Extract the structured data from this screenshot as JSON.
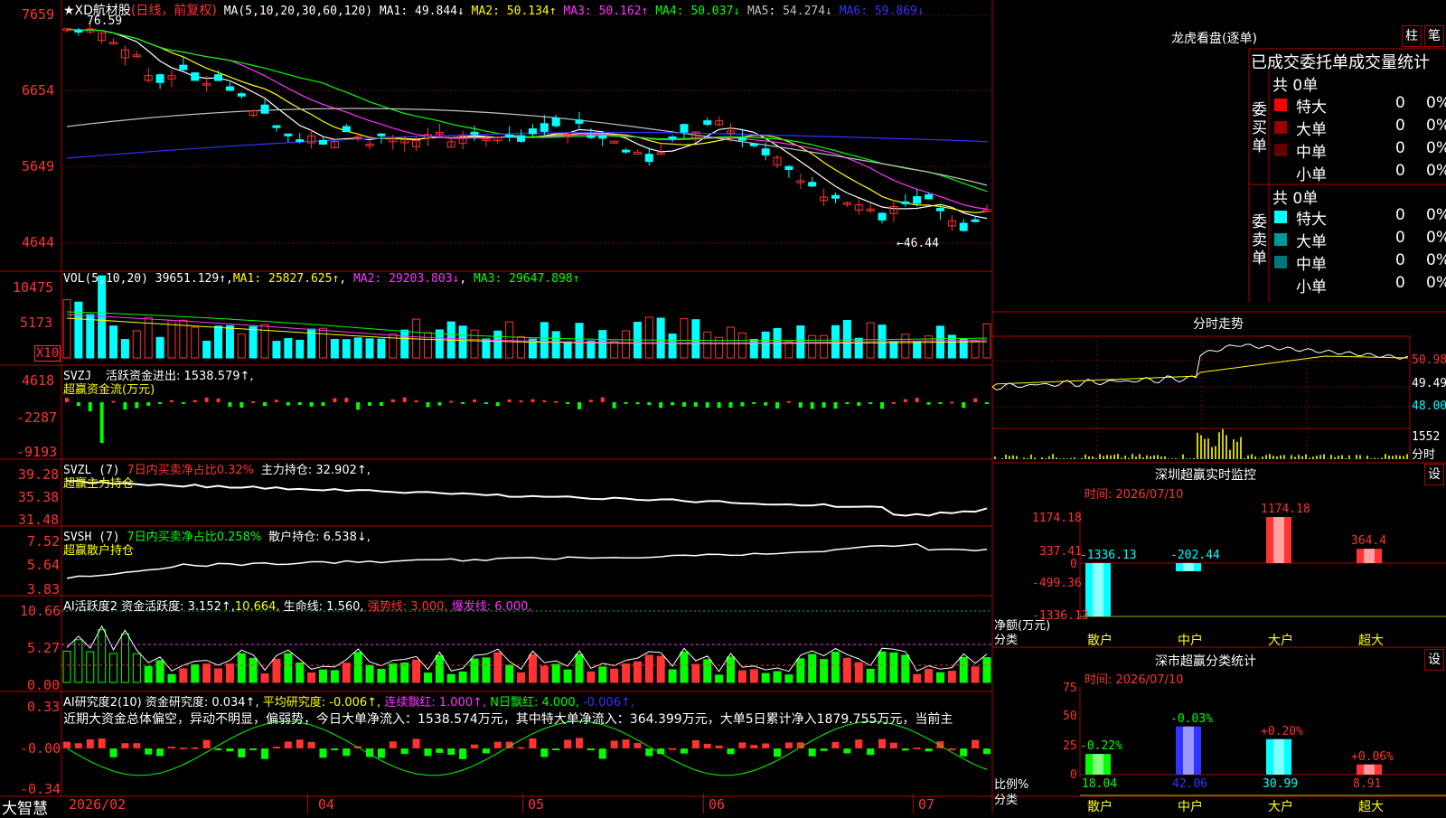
{
  "stock": {
    "title": "★XD航材股",
    "period": "(日线，前复权)",
    "ma_label": "MA(5,10,20,30,60,120)",
    "ma_values": [
      {
        "name": "MA1",
        "value": "49.844↓",
        "color": "#ffffff"
      },
      {
        "name": "MA2",
        "value": "50.134↑",
        "color": "#ffff00"
      },
      {
        "name": "MA3",
        "value": "50.162↑",
        "color": "#ff33ff"
      },
      {
        "name": "MA4",
        "value": "50.037↓",
        "color": "#00ff00"
      },
      {
        "name": "MA5",
        "value": "54.274↓",
        "color": "#c0c0c0"
      },
      {
        "name": "MA6",
        "value": "59.869↓",
        "color": "#3333ff"
      }
    ],
    "high_mark": "76.59",
    "low_mark": "←46.44",
    "price_ticks": [
      "7659",
      "6654",
      "5649",
      "4644"
    ],
    "x_ticks": [
      "2026/02",
      "04",
      "05",
      "06",
      "07"
    ],
    "brand": "大智慧"
  },
  "panels": {
    "vol": {
      "label": "VOL(5,10,20)",
      "value": "39651.129↑",
      "items": [
        {
          "name": "MA1",
          "value": "25827.625↑",
          "color": "#ffff00"
        },
        {
          "name": "MA2",
          "value": "29203.803↓",
          "color": "#ff33ff"
        },
        {
          "name": "MA3",
          "value": "29647.898↑",
          "color": "#00ff00"
        }
      ],
      "ticks": [
        "10475",
        "5173"
      ],
      "unit": "X10"
    },
    "svzj": {
      "label": "SVZJ",
      "text": "活跃资金进出: 1538.579↑,",
      "sub": "超赢资金流(万元)",
      "ticks": [
        "4618",
        "-2287",
        "-9193"
      ]
    },
    "svzl": {
      "label": "SVZL (7)",
      "text1": "7日内买卖净占比0.32%",
      "text2": "主力持仓: 32.902↑,",
      "sub": "超赢主力持仓",
      "ticks": [
        "39.28",
        "35.38",
        "31.48"
      ]
    },
    "svsh": {
      "label": "SVSH (7)",
      "text1": "7日内买卖净占比0.258%",
      "text2": "散户持仓: 6.538↓,",
      "sub": "超赢散户持仓",
      "ticks": [
        "7.52",
        "5.64",
        "3.83"
      ]
    },
    "ai1": {
      "label": "AI活跃度2",
      "t1": "资金活跃度: 3.152↑,",
      "t2": "10.664,",
      "t3": "生命线: 1.560,",
      "t4": "强势线: 3.000,",
      "t5": "爆发线: 6.000,",
      "ticks": [
        "10.66",
        "5.27",
        "0.00"
      ]
    },
    "ai2": {
      "label": "AI研究度2(10)",
      "t1": "资金研究度: 0.034↑,",
      "t2": "平均研究度: -0.006↑,",
      "t3": "连续飘红: 1.000↑,",
      "t4": "N日飘红: 4.000,",
      "t5": "-0.006↑,",
      "summary": "近期大资金总体偏空，异动不明显，偏弱势，今日大单净流入：1538.574万元，其中特大单净流入：364.399万元，大单5日累计净入1879.755万元，当前主",
      "ticks": [
        "0.33",
        "-0.00",
        "-0.34"
      ]
    }
  },
  "right": {
    "lhb_title": "龙虎看盘(逐单)",
    "btn1": "柱",
    "btn2": "笔",
    "header": "已成交委托单成交量统计",
    "buy_label": "委买单",
    "sell_label": "委卖单",
    "buy_total": "共 0单",
    "sell_total": "共 0单",
    "buy_rows": [
      {
        "name": "特大",
        "vol": "0",
        "pct": "0%",
        "color": "#ff0000"
      },
      {
        "name": "大单",
        "vol": "0",
        "pct": "0%",
        "color": "#990000"
      },
      {
        "name": "中单",
        "vol": "0",
        "pct": "0%",
        "color": "#660000"
      },
      {
        "name": "小单",
        "vol": "0",
        "pct": "0%",
        "color": "#000000"
      }
    ],
    "sell_rows": [
      {
        "name": "特大",
        "vol": "0",
        "pct": "0%",
        "color": "#00ffff"
      },
      {
        "name": "大单",
        "vol": "0",
        "pct": "0%",
        "color": "#009999"
      },
      {
        "name": "中单",
        "vol": "0",
        "pct": "0%",
        "color": "#007777"
      },
      {
        "name": "小单",
        "vol": "0",
        "pct": "0%",
        "color": "#000000"
      }
    ],
    "fenshi_title": "分时走势",
    "fenshi_ticks": [
      "50.98",
      "49.49",
      "48.00"
    ],
    "fenshi_vol": "1552",
    "fenshi_vol_label": "分时",
    "monitor_title": "深圳超赢实时监控",
    "monitor_btn": "设",
    "monitor_time": "时间: 2026/07/10",
    "monitor_ticks": [
      "1174.18",
      "337.41",
      "0",
      "-499.36",
      "-1336.13"
    ],
    "monitor_bars": [
      {
        "cat": "散户",
        "value": -1336.13,
        "label": "-1336.13",
        "color": "#00ffff"
      },
      {
        "cat": "中户",
        "value": -202.44,
        "label": "-202.44",
        "color": "#00ffff"
      },
      {
        "cat": "大户",
        "value": 1174.18,
        "label": "1174.18",
        "color": "#ff3333"
      },
      {
        "cat": "超大",
        "value": 364.4,
        "label": "364.4",
        "color": "#ff3333"
      }
    ],
    "monitor_unit": "净额(万元)",
    "monitor_cat": "分类",
    "class_title": "深市超赢分类统计",
    "class_btn": "设",
    "class_time": "时间: 2026/07/10",
    "class_ticks": [
      "75",
      "50",
      "25",
      "0"
    ],
    "class_bars": [
      {
        "cat": "散户",
        "value": 18.04,
        "label": "18.04",
        "chg": "-0.22%",
        "color": "#00ff00",
        "chgcolor": "#00ff00"
      },
      {
        "cat": "中户",
        "value": 42.06,
        "label": "42.06",
        "chg": "-0.03%",
        "color": "#3333ff",
        "chgcolor": "#00ff00"
      },
      {
        "cat": "大户",
        "value": 30.99,
        "label": "30.99",
        "chg": "+0.20%",
        "color": "#00ffff",
        "chgcolor": "#ff3333"
      },
      {
        "cat": "超大",
        "value": 8.91,
        "label": "8.91",
        "chg": "+0.06%",
        "color": "#ff3333",
        "chgcolor": "#ff3333"
      }
    ],
    "class_unit": "比例%",
    "class_cat": "分类"
  }
}
